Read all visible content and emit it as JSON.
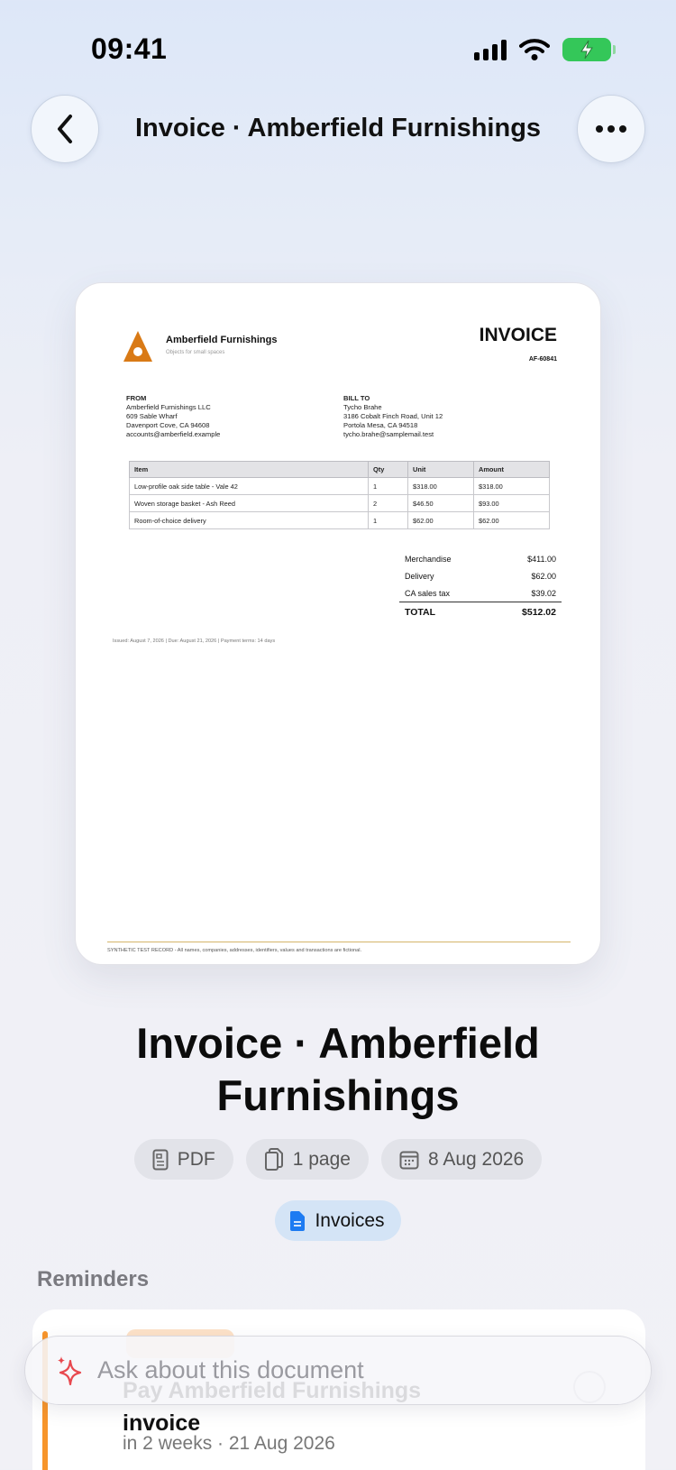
{
  "status_bar": {
    "time": "09:41"
  },
  "nav": {
    "title": "Invoice · Amberfield Furnishings"
  },
  "document": {
    "company_name": "Amberfield Furnishings",
    "tagline": "Objects for small spaces",
    "heading": "INVOICE",
    "invoice_number": "AF-60841",
    "from": {
      "label": "FROM",
      "lines": [
        "Amberfield Furnishings LLC",
        "609 Sable Wharf",
        "Davenport Cove, CA 94608",
        "accounts@amberfield.example"
      ]
    },
    "bill_to": {
      "label": "BILL TO",
      "lines": [
        "Tycho Brahe",
        "3186 Cobalt Finch Road, Unit 12",
        "Portola Mesa, CA 94518",
        "tycho.brahe@samplemail.test"
      ]
    },
    "table": {
      "headers": [
        "Item",
        "Qty",
        "Unit",
        "Amount"
      ],
      "rows": [
        [
          "Low-profile oak side table - Vale 42",
          "1",
          "$318.00",
          "$318.00"
        ],
        [
          "Woven storage basket - Ash Reed",
          "2",
          "$46.50",
          "$93.00"
        ],
        [
          "Room-of-choice delivery",
          "1",
          "$62.00",
          "$62.00"
        ]
      ]
    },
    "totals": [
      {
        "label": "Merchandise",
        "value": "$411.00"
      },
      {
        "label": "Delivery",
        "value": "$62.00"
      },
      {
        "label": "CA sales tax",
        "value": "$39.02"
      },
      {
        "label": "TOTAL",
        "value": "$512.02"
      }
    ],
    "issued_line": "Issued: August 7, 2026 | Due: August 21, 2026 | Payment terms: 14 days",
    "footer": "SYNTHETIC TEST RECORD - All names, companies, addresses, identifiers, values and transactions are fictional.",
    "logo_color": "#d97a16"
  },
  "title_line1": "Invoice · Amberfield",
  "title_line2": "Furnishings",
  "chips": {
    "type": "PDF",
    "pages": "1 page",
    "date": "8 Aug 2026"
  },
  "category_tag": "Invoices",
  "reminders": {
    "section_label": "Reminders",
    "item": {
      "title": "Pay Amberfield Furnishings invoice",
      "subtitle": "in 2 weeks · 21 Aug 2026",
      "accent_color": "#f7952b"
    }
  },
  "ask_bar": {
    "placeholder": "Ask about this document",
    "icon": "sparkle-icon",
    "icon_color": "#e8484e"
  }
}
